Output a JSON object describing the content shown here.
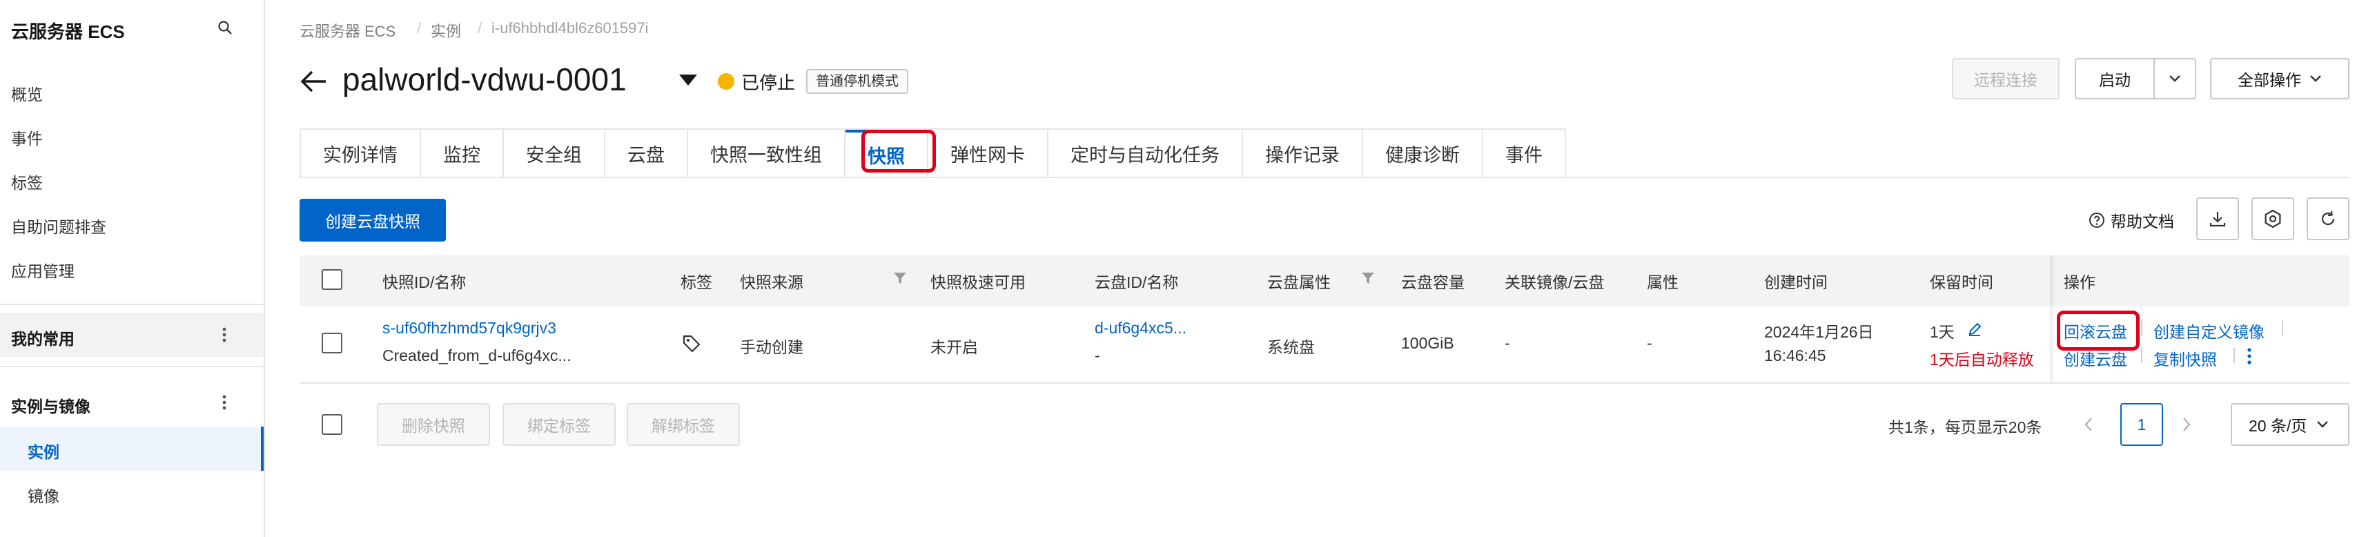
{
  "sidebar": {
    "title": "云服务器 ECS",
    "items": [
      "概览",
      "事件",
      "标签",
      "自助问题排查",
      "应用管理"
    ],
    "favorites_label": "我的常用",
    "section_label": "实例与镜像",
    "section_items": [
      "实例",
      "镜像"
    ]
  },
  "breadcrumb": [
    "云服务器 ECS",
    "实例",
    "i-uf6hbhdl4bl6z601597i"
  ],
  "header": {
    "title": "palworld-vdwu-0001",
    "status": "已停止",
    "stop_mode": "普通停机模式",
    "buttons": {
      "remote": "远程连接",
      "start": "启动",
      "all_ops": "全部操作"
    }
  },
  "tabs": [
    "实例详情",
    "监控",
    "安全组",
    "云盘",
    "快照一致性组",
    "快照",
    "弹性网卡",
    "定时与自动化任务",
    "操作记录",
    "健康诊断",
    "事件"
  ],
  "active_tab": "快照",
  "toolbar": {
    "create_snapshot": "创建云盘快照",
    "help": "帮助文档"
  },
  "table": {
    "columns": [
      "快照ID/名称",
      "标签",
      "快照来源",
      "快照极速可用",
      "云盘ID/名称",
      "云盘属性",
      "云盘容量",
      "关联镜像/云盘",
      "属性",
      "创建时间",
      "保留时间",
      "操作"
    ],
    "rows": [
      {
        "id": "s-uf60fhzhmd57qk9grjv3",
        "name": "Created_from_d-uf6g4xc...",
        "source": "手动创建",
        "instant_access": "未开启",
        "disk_id": "d-uf6g4xc5...",
        "disk_name": "-",
        "disk_type": "系统盘",
        "capacity": "100GiB",
        "related": "-",
        "attribute": "-",
        "created_date": "2024年1月26日",
        "created_time": "16:46:45",
        "retention": "1天",
        "retention_note": "1天后自动释放",
        "actions": [
          "回滚云盘",
          "创建自定义镜像",
          "创建云盘",
          "复制快照"
        ]
      }
    ]
  },
  "footer": {
    "buttons": [
      "删除快照",
      "绑定标签",
      "解绑标签"
    ],
    "summary": "共1条，每页显示20条",
    "page": "1",
    "page_size": "20 条/页"
  },
  "colors": {
    "accent": "#0064c8",
    "highlight": "#e0001a",
    "status_stopped": "#f5b400"
  }
}
